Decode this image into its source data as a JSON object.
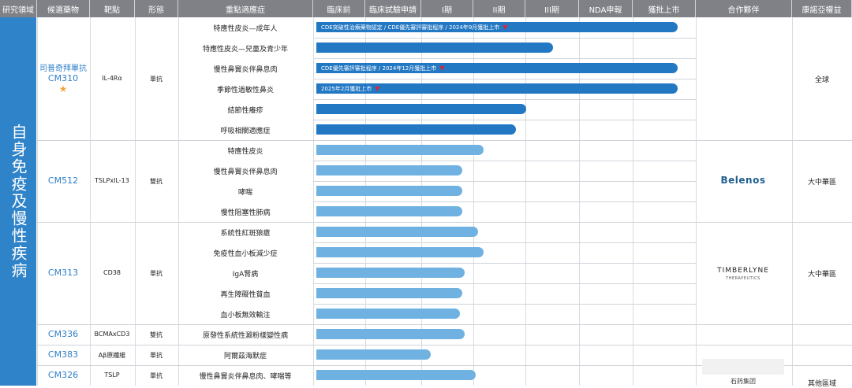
{
  "headers": [
    "研究領域",
    "候選藥物",
    "靶點",
    "形態",
    "重點適應症",
    "臨床前",
    "臨床試驗申請",
    "I期",
    "II期",
    "III期",
    "NDA申報",
    "獲批上市",
    "合作夥伴",
    "康諾亞權益"
  ],
  "research_area": "自身免疫及慢性疾病",
  "drugs": [
    {
      "name_cn": "司普奇拜單抗",
      "name": "CM310",
      "star": "★",
      "target": "IL-4Rα",
      "form": "單抗",
      "partner": "",
      "rights": "全球"
    },
    {
      "name_cn": "",
      "name": "CM512",
      "star": "",
      "target": "TSLPxIL-13",
      "form": "雙抗",
      "partner": "Belenos",
      "rights": "大中華區"
    },
    {
      "name_cn": "",
      "name": "CM313",
      "star": "",
      "target": "CD38",
      "form": "單抗",
      "partner": "TIMBERLYNE",
      "partner_sub": "THERAPEUTICS",
      "rights": "大中華區"
    },
    {
      "name_cn": "",
      "name": "CM336",
      "star": "",
      "target": "BCMAxCD3",
      "form": "雙抗",
      "partner": "",
      "rights": ""
    },
    {
      "name_cn": "",
      "name": "CM383",
      "star": "",
      "target": "Aβ原纖維",
      "form": "單抗",
      "partner": "",
      "rights": ""
    },
    {
      "name_cn": "",
      "name": "CM326",
      "star": "",
      "target": "TSLP",
      "form": "單抗",
      "partner": "",
      "rights": "其他區域"
    }
  ],
  "watermark_text": "石药集团",
  "chart_data": {
    "type": "bar",
    "orientation": "horizontal",
    "stages": [
      "臨床前",
      "臨床試驗申請",
      "I期",
      "II期",
      "III期",
      "NDA申報",
      "獲批上市"
    ],
    "rows": [
      {
        "drug": "CM310",
        "indication": "特應性皮炎—成年人",
        "progress": 6.85,
        "shade": "dark",
        "note": "CDE突破性治療藥物認定 / CDE優先審評審批程序 / 2024年9月獲批上市",
        "flag": true
      },
      {
        "drug": "CM310",
        "indication": "特應性皮炎—兒童及青少年",
        "progress": 4.5,
        "shade": "dark",
        "note": "",
        "flag": false
      },
      {
        "drug": "CM310",
        "indication": "慢性鼻竇炎伴鼻息肉",
        "progress": 6.85,
        "shade": "dark",
        "note": "CDE優先審評審批程序 / 2024年12月獲批上市",
        "flag": true
      },
      {
        "drug": "CM310",
        "indication": "季節性過敏性鼻炎",
        "progress": 6.85,
        "shade": "dark",
        "note": "2025年2月獲批上市",
        "flag": true
      },
      {
        "drug": "CM310",
        "indication": "結節性癢疹",
        "progress": 4.0,
        "shade": "dark",
        "note": "",
        "flag": false
      },
      {
        "drug": "CM310",
        "indication": "呼吸相關適應症",
        "progress": 3.8,
        "shade": "dark",
        "note": "",
        "flag": false
      },
      {
        "drug": "CM512",
        "indication": "特應性皮炎",
        "progress": 3.2,
        "shade": "light",
        "note": "",
        "flag": false
      },
      {
        "drug": "CM512",
        "indication": "慢性鼻竇炎伴鼻息肉",
        "progress": 2.8,
        "shade": "light",
        "note": "",
        "flag": false
      },
      {
        "drug": "CM512",
        "indication": "哮喘",
        "progress": 2.8,
        "shade": "light",
        "note": "",
        "flag": false
      },
      {
        "drug": "CM512",
        "indication": "慢性阻塞性肺病",
        "progress": 2.8,
        "shade": "light",
        "note": "",
        "flag": false
      },
      {
        "drug": "CM313",
        "indication": "系統性紅斑狼瘡",
        "progress": 3.1,
        "shade": "light",
        "note": "",
        "flag": false
      },
      {
        "drug": "CM313",
        "indication": "免疫性血小板減少症",
        "progress": 3.2,
        "shade": "light",
        "note": "",
        "flag": false
      },
      {
        "drug": "CM313",
        "indication": "IgA腎病",
        "progress": 2.85,
        "shade": "light",
        "note": "",
        "flag": false
      },
      {
        "drug": "CM313",
        "indication": "再生障礙性貧血",
        "progress": 2.8,
        "shade": "light",
        "note": "",
        "flag": false
      },
      {
        "drug": "CM313",
        "indication": "血小板無效輸注",
        "progress": 2.75,
        "shade": "light",
        "note": "",
        "flag": false
      },
      {
        "drug": "CM336",
        "indication": "原發性系統性澱粉樣變性病",
        "progress": 2.85,
        "shade": "light",
        "note": "",
        "flag": false
      },
      {
        "drug": "CM383",
        "indication": "阿爾茲海默症",
        "progress": 2.2,
        "shade": "light",
        "note": "",
        "flag": false
      },
      {
        "drug": "CM326",
        "indication": "慢性鼻竇炎伴鼻息肉、哮喘等",
        "progress": 3.05,
        "shade": "light",
        "note": "",
        "flag": false
      }
    ]
  }
}
